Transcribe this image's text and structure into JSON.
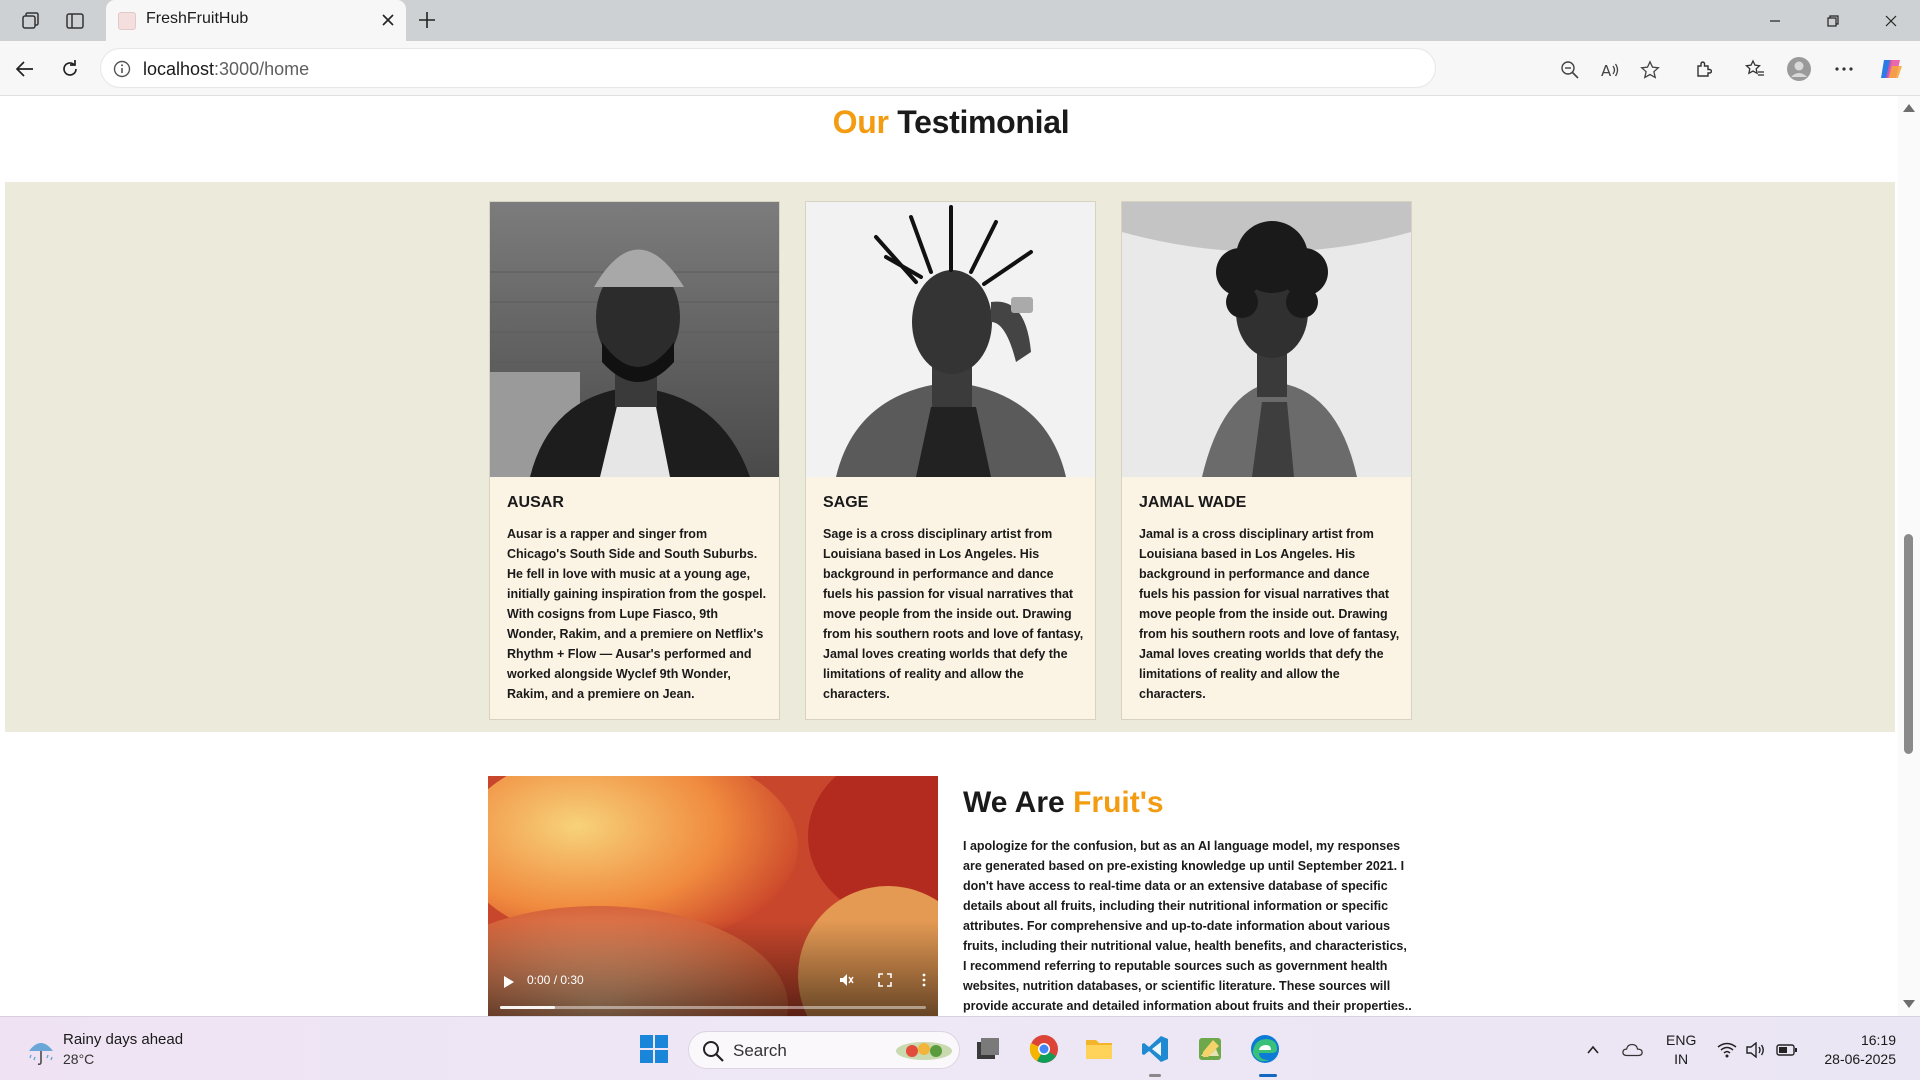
{
  "browser": {
    "tab_title": "FreshFruitHub",
    "url_host": "localhost",
    "url_path": ":3000/home"
  },
  "page": {
    "testimonial_title_accent": "Our",
    "testimonial_title_rest": "Testimonial",
    "accent_color": "#f39c12",
    "testimonials": [
      {
        "name": "AUSAR",
        "text": "Ausar is a rapper and singer from Chicago's South Side and South Suburbs. He fell in love with music at a young age, initially gaining inspiration from the gospel. With cosigns from Lupe Fiasco, 9th Wonder, Rakim, and a premiere on Netflix's Rhythm + Flow — Ausar's performed and worked alongside Wyclef 9th Wonder, Rakim, and a premiere on Jean."
      },
      {
        "name": "SAGE",
        "text": "Sage is a cross disciplinary artist from Louisiana based in Los Angeles. His background in performance and dance fuels his passion for visual narratives that move people from the inside out. Drawing from his southern roots and love of fantasy, Jamal loves creating worlds that defy the limitations of reality and allow the characters."
      },
      {
        "name": "JAMAL WADE",
        "text": "Jamal is a cross disciplinary artist from Louisiana based in Los Angeles. His background in performance and dance fuels his passion for visual narratives that move people from the inside out. Drawing from his southern roots and love of fantasy, Jamal loves creating worlds that defy the limitations of reality and allow the characters."
      }
    ],
    "about_title_rest": "We Are",
    "about_title_accent": "Fruit's",
    "about_text": "I apologize for the confusion, but as an AI language model, my responses are generated based on pre-existing knowledge up until September 2021. I don't have access to real-time data or an extensive database of specific details about all fruits, including their nutritional information or specific attributes. For comprehensive and up-to-date information about various fruits, including their nutritional value, health benefits, and characteristics, I recommend referring to reputable sources such as government health websites, nutrition databases, or scientific literature. These sources will provide accurate and detailed information about fruits and their properties..",
    "video_time": "0:00 / 0:30",
    "video_progress": 0.13
  },
  "taskbar": {
    "weather_line1": "Rainy days ahead",
    "weather_line2": "28°C",
    "search_label": "Search",
    "lang_line1": "ENG",
    "lang_line2": "IN",
    "time": "16:19",
    "date": "28-06-2025"
  }
}
